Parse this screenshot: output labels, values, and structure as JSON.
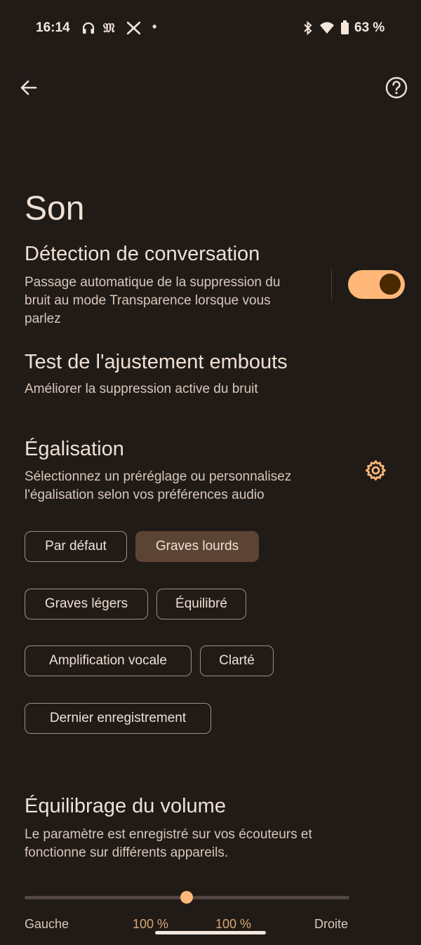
{
  "status_bar": {
    "time": "16:14",
    "notification_icons": [
      "headphones-icon",
      "le-monde-icon",
      "x-icon"
    ],
    "overflow_dot": "•",
    "system_icons": [
      "bluetooth-icon",
      "wifi-icon",
      "battery-icon"
    ],
    "battery_pct": "63 %"
  },
  "app_bar": {
    "back_icon": "back-arrow-icon",
    "help_icon": "help-icon"
  },
  "page": {
    "title": "Son"
  },
  "conversation": {
    "title": "Détection de conversation",
    "desc_lines": [
      "Passage automatique de la suppression du",
      "bruit au mode Transparence lorsque vous",
      "parlez"
    ],
    "toggle_on": true
  },
  "eartip": {
    "title": "Test de l'ajustement embouts",
    "desc": "Améliorer la suppression active du bruit"
  },
  "equalizer": {
    "title": "Égalisation",
    "desc_lines": [
      "Sélectionnez un préréglage ou personnalisez",
      "l'égalisation selon vos préférences audio"
    ],
    "settings_icon": "gear-icon",
    "presets": [
      {
        "label": "Par défaut",
        "selected": false
      },
      {
        "label": "Graves lourds",
        "selected": true
      },
      {
        "label": "Graves légers",
        "selected": false
      },
      {
        "label": "Équilibré",
        "selected": false
      },
      {
        "label": "Amplification vocale",
        "selected": false
      },
      {
        "label": "Clarté",
        "selected": false
      },
      {
        "label": "Dernier enregistrement",
        "selected": false
      }
    ]
  },
  "volume_balance": {
    "title": "Équilibrage du volume",
    "desc_lines": [
      "Le paramètre est enregistré sur vos écouteurs et",
      "fonctionne sur différents appareils."
    ],
    "balance_position": 0.5,
    "left_label": "Gauche",
    "left_value": "100 %",
    "right_value": "100 %",
    "right_label": "Droite"
  },
  "colors": {
    "background": "#211b17",
    "accent": "#ffb77a",
    "selected_chip": "#5c4434"
  }
}
